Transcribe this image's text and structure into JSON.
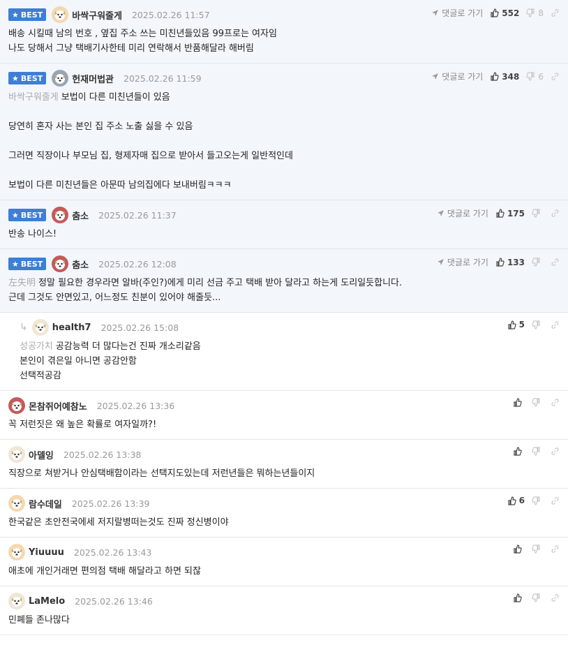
{
  "labels": {
    "best": "BEST",
    "reply_to": "댓글로 가기"
  },
  "comments": [
    {
      "best": true,
      "nick": "바싹구워줄게",
      "time": "2025.02.26 11:57",
      "likes": "552",
      "dislikes": "8",
      "show_reply_link": true,
      "avatar": "dog",
      "mention": "",
      "lines": [
        "배송 시킬때 남의 번호 , 옆집 주소 쓰는 미친년들있음 99프로는 여자임",
        "나도 당해서 그냥 택배기사한테 미리 연락해서 반품해달라 해버림"
      ]
    },
    {
      "best": true,
      "nick": "헌재머법관",
      "time": "2025.02.26 11:59",
      "likes": "348",
      "dislikes": "6",
      "show_reply_link": true,
      "avatar": "gray",
      "mention": "바싹구워줄게",
      "lines": [
        "보법이 다른 미친년들이 있음",
        "",
        "당연히 혼자 사는 본인 집 주소 노출 싫을 수 있음",
        "",
        "그러면 직장이나 부모님 집, 형제자매 집으로 받아서 들고오는게 일반적인데",
        "",
        "보법이 다른 미친년들은 아문따 남의집에다 보내버림ㅋㅋㅋ"
      ]
    },
    {
      "best": true,
      "nick": "춤소",
      "time": "2025.02.26 11:37",
      "likes": "175",
      "dislikes": "",
      "show_reply_link": true,
      "avatar": "red",
      "mention": "",
      "lines": [
        "반송 나이스!"
      ]
    },
    {
      "best": true,
      "nick": "춤소",
      "time": "2025.02.26 12:08",
      "likes": "133",
      "dislikes": "",
      "show_reply_link": true,
      "avatar": "red",
      "mention": "左失明",
      "lines": [
        "정말 필요한 경우라면 알바(주인?)에게 미리 선금 주고 택배 받아 달라고 하는게 도리일듯합니다.",
        "근데 그것도 안면있고, 어느정도 친분이 있어야 해줄듯..."
      ]
    },
    {
      "best": false,
      "reply": true,
      "nick": "health7",
      "time": "2025.02.26 15:08",
      "likes": "5",
      "dislikes": "",
      "show_reply_link": false,
      "avatar": "cream",
      "mention": "성공가치",
      "lines": [
        "공감능력 더 많다는건 진짜 개소리같음",
        "본인이 겪은일 아니면 공감안함",
        "선택적공감"
      ]
    },
    {
      "best": false,
      "nick": "몬참쥐어예참노",
      "time": "2025.02.26 13:36",
      "likes": "",
      "dislikes": "",
      "show_reply_link": false,
      "avatar": "red",
      "mention": "",
      "lines": [
        "꼭 저런짓은 왜 높은 확률로 여자일까?!"
      ]
    },
    {
      "best": false,
      "nick": "아델잉",
      "time": "2025.02.26 13:38",
      "likes": "",
      "dislikes": "",
      "show_reply_link": false,
      "avatar": "cream",
      "mention": "",
      "lines": [
        "직장으로 쳐받거나 안심택배함이라는 선택지도있는데 저런년들은 뭐하는년들이지"
      ]
    },
    {
      "best": false,
      "nick": "람수데일",
      "time": "2025.02.26 13:39",
      "likes": "6",
      "dislikes": "",
      "show_reply_link": false,
      "avatar": "dog",
      "mention": "",
      "lines": [
        "한국같은 초안전국에세 저지랄병떠는것도 진짜 정신병이야"
      ]
    },
    {
      "best": false,
      "nick": "Yiuuuu",
      "time": "2025.02.26 13:43",
      "likes": "",
      "dislikes": "",
      "show_reply_link": false,
      "avatar": "dog",
      "mention": "",
      "lines": [
        "애초에 개인거래면 편의점 택배 해달라고 하면 되잖"
      ]
    },
    {
      "best": false,
      "nick": "LaMelo",
      "time": "2025.02.26 13:46",
      "likes": "",
      "dislikes": "",
      "show_reply_link": false,
      "avatar": "cream",
      "mention": "",
      "lines": [
        "민폐들 존나많다"
      ]
    }
  ]
}
